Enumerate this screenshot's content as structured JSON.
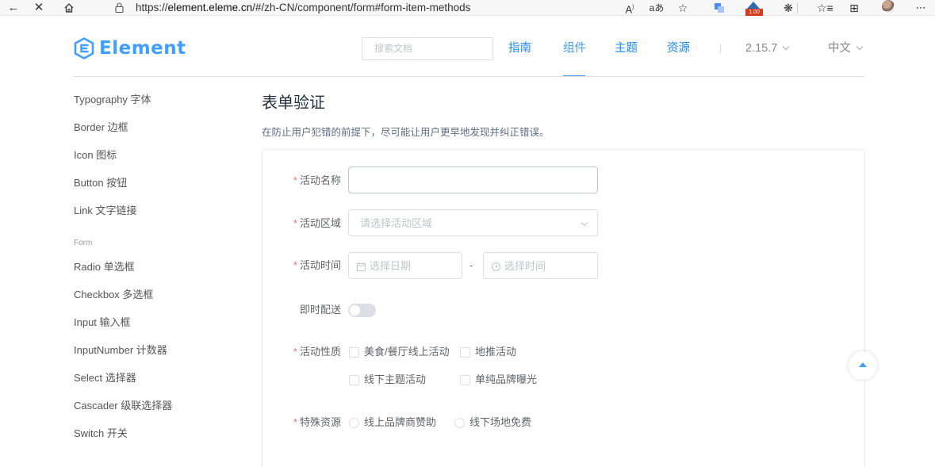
{
  "browser": {
    "url_prefix": "https://",
    "url_domain": "element.eleme.cn",
    "url_path": "/#/zh-CN/component/form#form-item-methods",
    "rate_badge": "1.00",
    "icons": [
      "back-arrow-icon",
      "close-icon",
      "home-icon",
      "lock-icon",
      "read-aloud-icon",
      "translate-icon",
      "favorite-star-icon",
      "extension-icon",
      "favorites-icon",
      "collections-icon",
      "more-icon"
    ]
  },
  "header": {
    "logo_text": "Element",
    "search_placeholder": "搜索文档",
    "nav": [
      "指南",
      "组件",
      "主题",
      "资源"
    ],
    "version": "2.15.7",
    "language": "中文",
    "accent": "#409eff"
  },
  "sidebar": {
    "items_top": [
      "Typography 字体",
      "Border 边框",
      "Icon 图标",
      "Button 按钮",
      "Link 文字链接"
    ],
    "group": "Form",
    "items_form": [
      "Radio 单选框",
      "Checkbox 多选框",
      "Input 输入框",
      "InputNumber 计数器",
      "Select 选择器",
      "Cascader 级联选择器",
      "Switch 开关"
    ]
  },
  "main": {
    "title": "表单验证",
    "description": "在防止用户犯错的前提下，尽可能让用户更早地发现并纠正错误。",
    "form": {
      "required_mark": "*",
      "name_label": "活动名称",
      "name_value": "",
      "region_label": "活动区域",
      "region_placeholder": "请选择活动区域",
      "time_label": "活动时间",
      "date_placeholder": "选择日期",
      "time_placeholder": "选择时间",
      "range_sep": "-",
      "delivery_label": "即时配送",
      "delivery_on": false,
      "type_label": "活动性质",
      "type_options": [
        "美食/餐厅线上活动",
        "地推活动",
        "线下主题活动",
        "单纯品牌曝光"
      ],
      "resource_label": "特殊资源",
      "resource_options": [
        "线上品牌商赞助",
        "线下场地免费"
      ]
    }
  }
}
